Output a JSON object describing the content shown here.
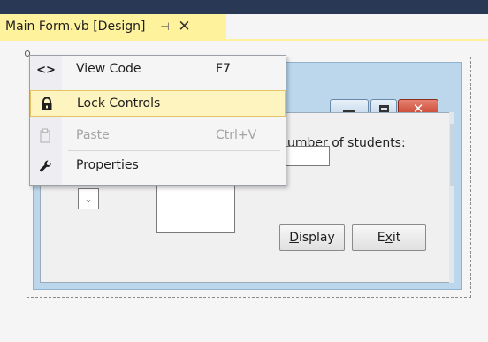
{
  "tab": {
    "title": "Main Form.vb [Design]",
    "pin_glyph": "⊣",
    "close_glyph": "✕"
  },
  "form": {
    "label_students": "umber of students:",
    "display_button": {
      "mnemonic": "D",
      "rest": "isplay"
    },
    "exit_button": {
      "before": "E",
      "mnemonic": "x",
      "after": "it"
    },
    "combo_arrow_glyph": "⌄",
    "caption_close_glyph": "✕"
  },
  "context_menu": {
    "items": [
      {
        "label": "View Code",
        "shortcut": "F7",
        "icon": "code-icon",
        "glyph": "<>",
        "state": "normal"
      },
      {
        "label": "Lock Controls",
        "shortcut": "",
        "icon": "lock-icon",
        "glyph": "🔒",
        "state": "highlighted"
      },
      {
        "label": "Paste",
        "shortcut": "Ctrl+V",
        "icon": "paste-icon",
        "glyph": "📋",
        "state": "disabled"
      },
      {
        "label": "Properties",
        "shortcut": "",
        "icon": "wrench-icon",
        "glyph": "🔧",
        "state": "normal"
      }
    ]
  },
  "colors": {
    "tab_active": "#fff29d",
    "menu_highlight": "#fdf4bf",
    "topbar": "#293955",
    "close_button": "#c33c28"
  }
}
